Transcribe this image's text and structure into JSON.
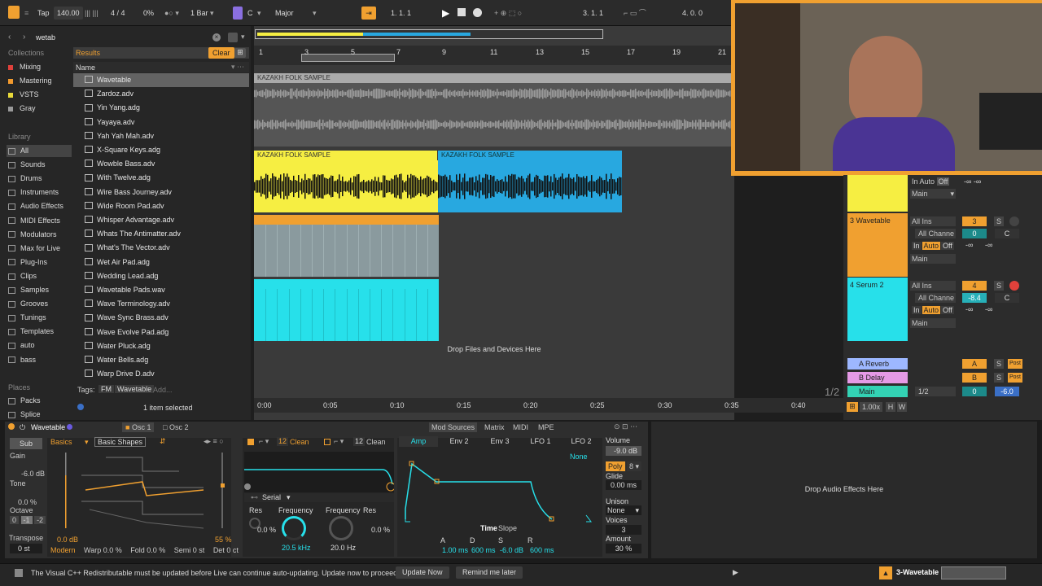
{
  "transport": {
    "tap": "Tap",
    "tempo": "140.00",
    "meter": "4 / 4",
    "swing": "0%",
    "quant": "1 Bar",
    "key": "C",
    "scale": "Major",
    "position": "1.   1.   1",
    "loop_start": "3.   1.   1",
    "loop_length": "4.   0.   0"
  },
  "browser": {
    "search_value": "wetab",
    "collections_title": "Collections",
    "collections": [
      {
        "label": "Mixing",
        "color": "#e0413b"
      },
      {
        "label": "Mastering",
        "color": "#f29a2e"
      },
      {
        "label": "VSTS",
        "color": "#e8d93a"
      },
      {
        "label": "Gray",
        "color": "#9a9a9a"
      }
    ],
    "library_title": "Library",
    "library": [
      "All",
      "Sounds",
      "Drums",
      "Instruments",
      "Audio Effects",
      "MIDI Effects",
      "Modulators",
      "Max for Live",
      "Plug-Ins",
      "Clips",
      "Samples",
      "Grooves",
      "Tunings",
      "Templates",
      "auto",
      "bass"
    ],
    "places_title": "Places",
    "places": [
      "Packs",
      "Splice"
    ],
    "results_label": "Results",
    "clear_label": "Clear",
    "name_header": "Name",
    "items": [
      "Wavetable",
      "Zardoz.adv",
      "Yin Yang.adg",
      "Yayaya.adv",
      "Yah Yah Mah.adv",
      "X-Square Keys.adg",
      "Wowble Bass.adv",
      "With Twelve.adg",
      "Wire Bass Journey.adv",
      "Wide Room Pad.adv",
      "Whisper Advantage.adv",
      "Whats The Antimatter.adv",
      "What's The Vector.adv",
      "Wet Air Pad.adg",
      "Wedding Lead.adg",
      "Wavetable Pads.wav",
      "Wave Terminology.adv",
      "Wave Sync Brass.adv",
      "Wave Evolve Pad.adg",
      "Water Pluck.adg",
      "Water Bells.adg",
      "Warp Drive D.adv"
    ],
    "tags_label": "Tags:",
    "tags": [
      "FM",
      "Wavetable",
      "Add..."
    ],
    "selected_count": "1 item selected"
  },
  "arrangement": {
    "bar_numbers": [
      "1",
      "3",
      "5",
      "7",
      "9",
      "11",
      "13",
      "15",
      "17",
      "19",
      "21"
    ],
    "time_labels": [
      "0:00",
      "0:05",
      "0:10",
      "0:15",
      "0:20",
      "0:25",
      "0:30",
      "0:35",
      "0:40"
    ],
    "clip_name": "KAZAKH FOLK SAMPLE",
    "drop_text": "Drop Files and Devices Here",
    "page_indicator": "1/2",
    "clip_colors": {
      "yellow": "#f6ee42",
      "blue": "#28a8e0",
      "orange": "#f0a030",
      "cyan": "#27e0ea",
      "gray": "#a9a9a9"
    }
  },
  "mixer": {
    "tracks": [
      {
        "name": "3 Wavetable",
        "color": "#f0a030",
        "input": "All Ins",
        "channel": "All Channe",
        "monitor": [
          "In",
          "Auto",
          "Off"
        ],
        "output": "Main",
        "num": "3",
        "vol": "0",
        "pan": "C",
        "send": "-∞"
      },
      {
        "name": "4 Serum 2",
        "color": "#27e0ea",
        "input": "All Ins",
        "channel": "All Channe",
        "monitor": [
          "In",
          "Auto",
          "Off"
        ],
        "output": "Main",
        "num": "4",
        "vol": "-8.4",
        "pan": "C",
        "send": "-∞"
      }
    ],
    "top_output": "Main",
    "top_monitor": [
      "In",
      "Auto",
      "Off"
    ],
    "returns": [
      {
        "name": "A Reverb",
        "color": "#9db7ff",
        "letter": "A"
      },
      {
        "name": "B Delay",
        "color": "#e59ae6",
        "letter": "B"
      },
      {
        "name": "Main",
        "color": "#33d2b4",
        "letter": "1/2"
      }
    ],
    "main_vol": "0",
    "main_vol2": "-6.0",
    "zoom": "1.00x",
    "h_label": "H",
    "w_label": "W"
  },
  "device": {
    "name": "Wavetable",
    "osc_tabs": [
      "Osc 1",
      "Osc 2"
    ],
    "sub_label": "Sub",
    "gain_label": "Gain",
    "gain_value": "-6.0 dB",
    "tone_label": "Tone",
    "tone_value": "0.0 %",
    "octave_label": "Octave",
    "octave_values": [
      "0",
      "-1",
      "-2"
    ],
    "transpose_label": "Transpose",
    "transpose_value": "0 st",
    "category": "Basics",
    "wavetable": "Basic Shapes",
    "osc_gain": "0.0 dB",
    "osc_pos": "55 %",
    "bottom_params": [
      "Modern",
      "Warp 0.0 %",
      "Fold 0.0 %",
      "Semi 0 st",
      "Det 0 ct"
    ],
    "filter1_type": "Clean",
    "filter1_num": "12",
    "filter2_type": "Clean",
    "filter2_num": "12",
    "routing": "Serial",
    "res_label": "Res",
    "freq_label": "Frequency",
    "res_value": "0.0 %",
    "freq_value": "20.5 kHz",
    "freq2_value": "20.0 Hz",
    "res2_value": "0.0 %",
    "mod_tabs": [
      "Mod Sources",
      "Matrix",
      "MIDI",
      "MPE"
    ],
    "env_tabs": [
      "Amp",
      "Env 2",
      "Env 3",
      "LFO 1",
      "LFO 2"
    ],
    "env_none": "None",
    "env_time": "Time",
    "env_slope": "Slope",
    "adsr_labels": [
      "A",
      "D",
      "S",
      "R"
    ],
    "adsr_values": [
      "1.00 ms",
      "600 ms",
      "-6.0 dB",
      "600 ms"
    ],
    "volume_label": "Volume",
    "volume_value": "-9.0 dB",
    "poly_label": "Poly",
    "poly_value": "8",
    "glide_label": "Glide",
    "glide_value": "0.00 ms",
    "unison_label": "Unison",
    "unison_value": "None",
    "voices_label": "Voices",
    "voices_value": "3",
    "amount_label": "Amount",
    "amount_value": "30 %",
    "drop_effects": "Drop Audio Effects Here"
  },
  "status": {
    "message": "The Visual C++ Redistributable must be updated before Live can continue auto-updating. Update now to proceed.",
    "update_btn": "Update Now",
    "remind_btn": "Remind me later",
    "track_name": "3-Wavetable"
  }
}
